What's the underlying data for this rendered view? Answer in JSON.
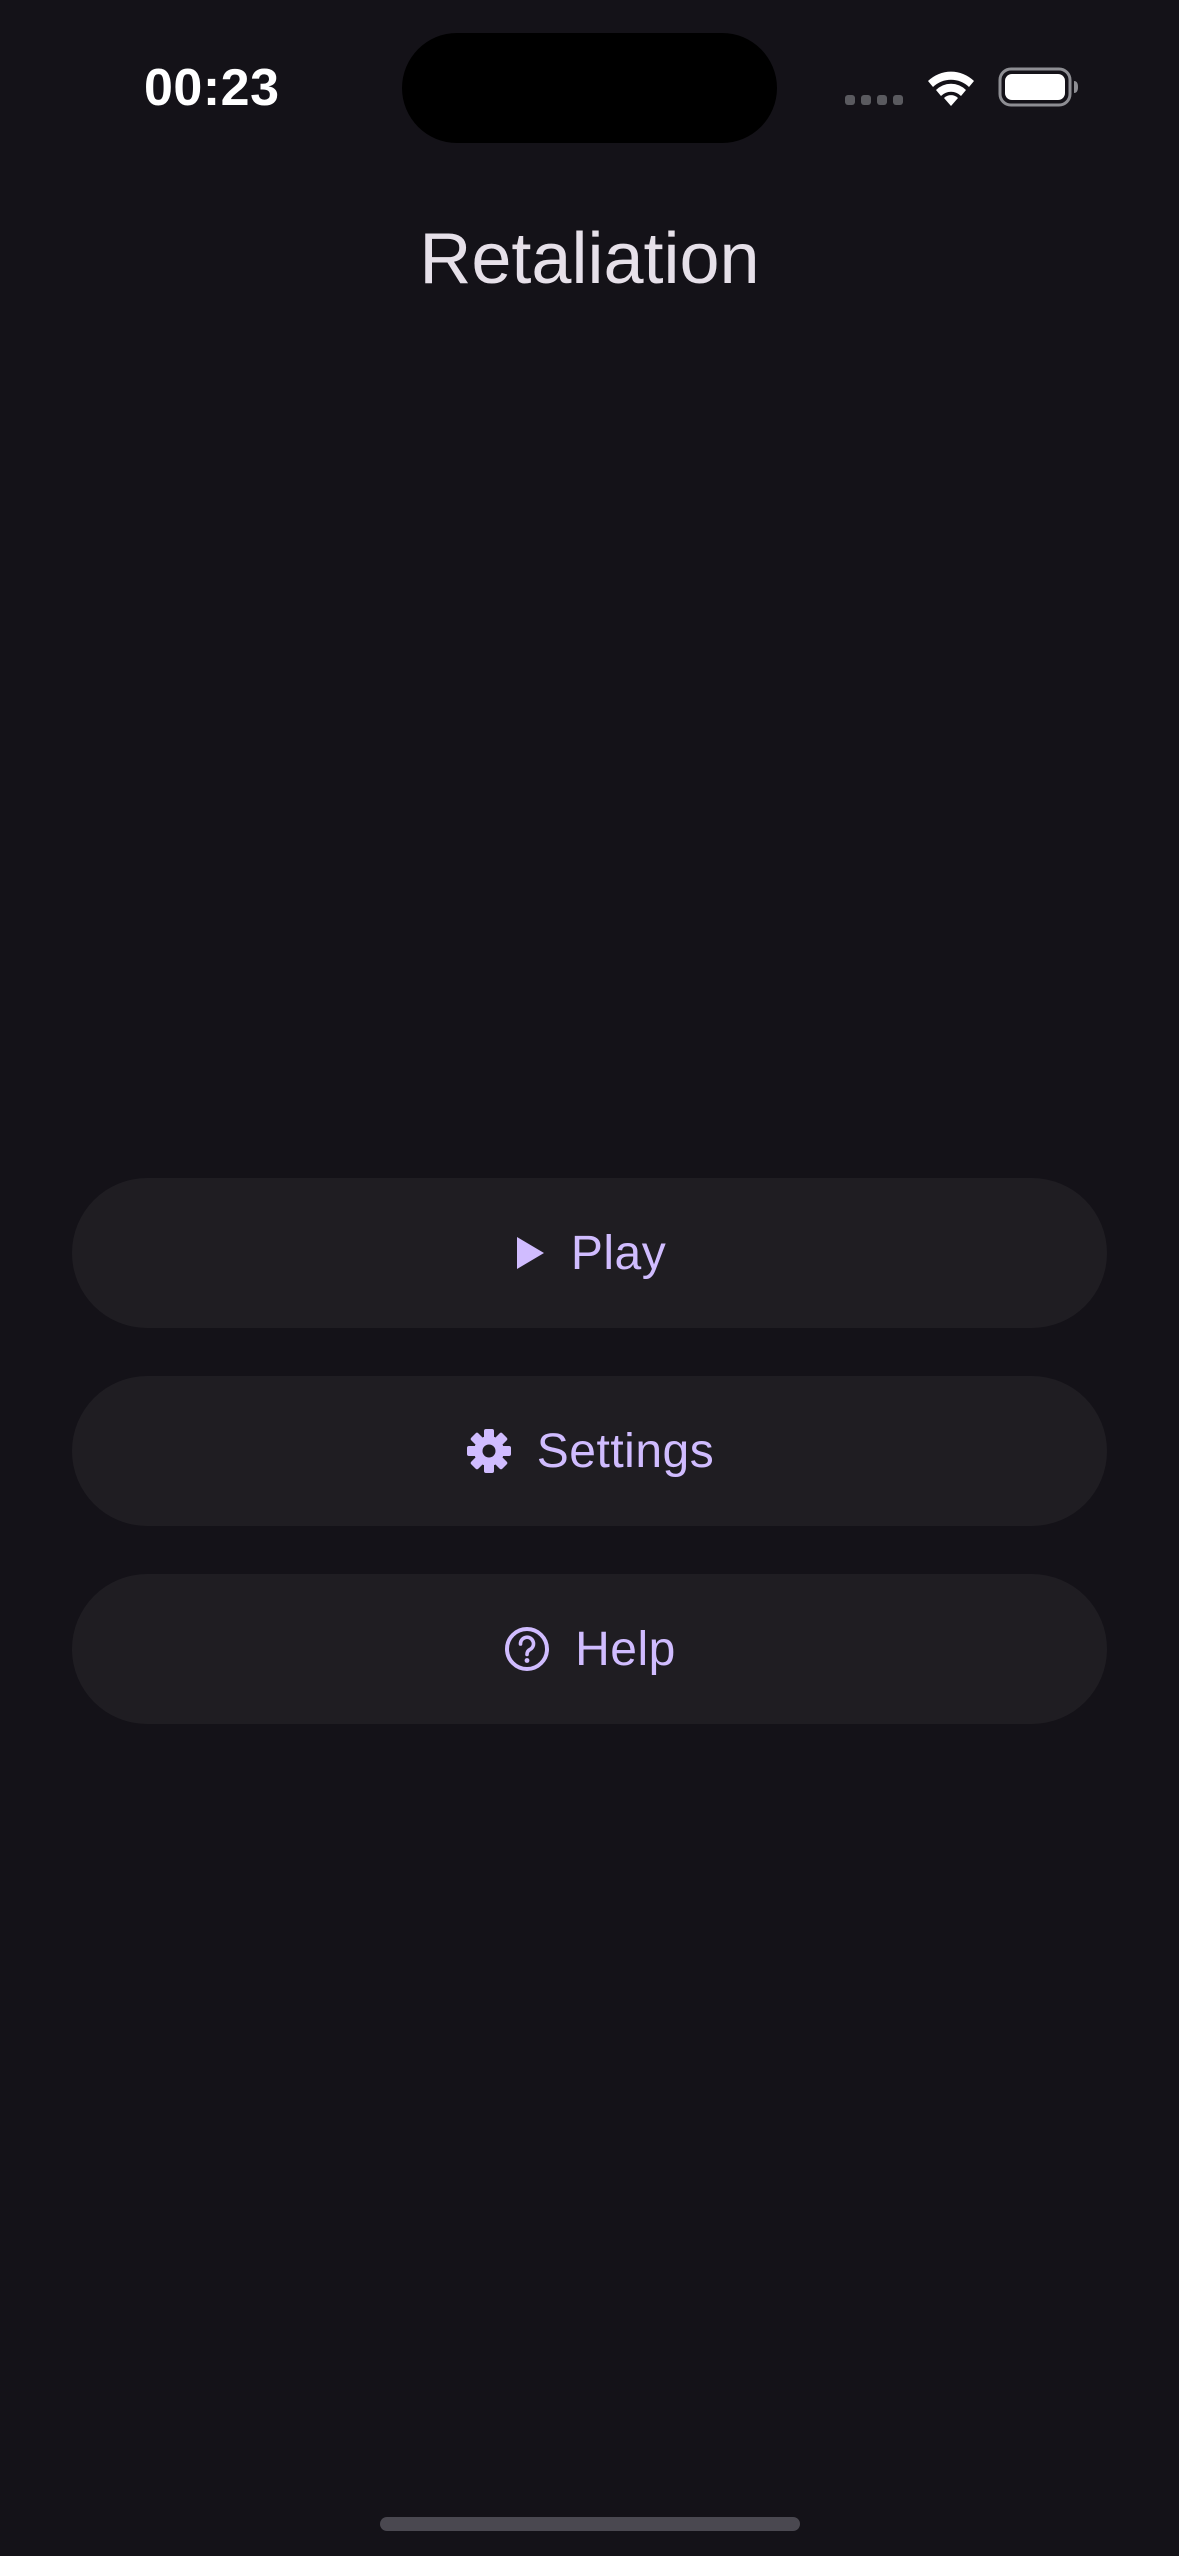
{
  "status_bar": {
    "time": "00:23",
    "icons": [
      "signal-icon",
      "wifi-icon",
      "battery-icon"
    ]
  },
  "app": {
    "title": "Retaliation"
  },
  "menu": {
    "play_label": "Play",
    "settings_label": "Settings",
    "help_label": "Help",
    "icons": [
      "play-icon",
      "gear-icon",
      "help-circle-icon"
    ]
  },
  "colors": {
    "background": "#141218",
    "button_background": "#1f1d22",
    "accent": "#d0bcff",
    "title_text": "#e6e0e9"
  }
}
